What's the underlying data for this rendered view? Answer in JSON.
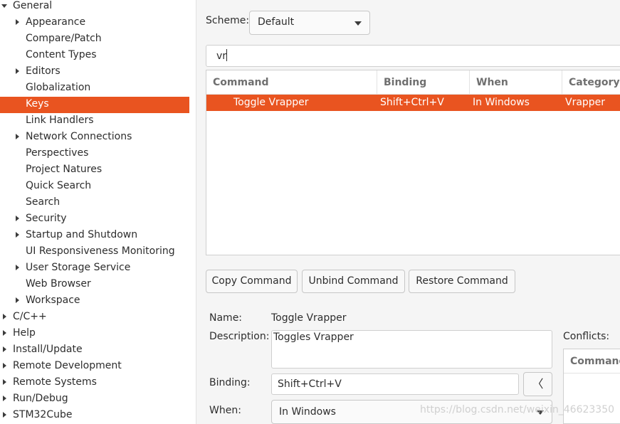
{
  "tree": {
    "items": [
      {
        "label": "General",
        "expander": "down",
        "level": 0
      },
      {
        "label": "Appearance",
        "expander": "right",
        "level": 1
      },
      {
        "label": "Compare/Patch",
        "expander": "none",
        "level": 1
      },
      {
        "label": "Content Types",
        "expander": "none",
        "level": 1
      },
      {
        "label": "Editors",
        "expander": "right",
        "level": 1
      },
      {
        "label": "Globalization",
        "expander": "none",
        "level": 1
      },
      {
        "label": "Keys",
        "expander": "none",
        "level": 1,
        "selected": true
      },
      {
        "label": "Link Handlers",
        "expander": "none",
        "level": 1
      },
      {
        "label": "Network Connections",
        "expander": "right",
        "level": 1
      },
      {
        "label": "Perspectives",
        "expander": "none",
        "level": 1
      },
      {
        "label": "Project Natures",
        "expander": "none",
        "level": 1
      },
      {
        "label": "Quick Search",
        "expander": "none",
        "level": 1
      },
      {
        "label": "Search",
        "expander": "none",
        "level": 1
      },
      {
        "label": "Security",
        "expander": "right",
        "level": 1
      },
      {
        "label": "Startup and Shutdown",
        "expander": "right",
        "level": 1
      },
      {
        "label": "UI Responsiveness Monitoring",
        "expander": "none",
        "level": 1
      },
      {
        "label": "User Storage Service",
        "expander": "right",
        "level": 1
      },
      {
        "label": "Web Browser",
        "expander": "none",
        "level": 1
      },
      {
        "label": "Workspace",
        "expander": "right",
        "level": 1
      },
      {
        "label": "C/C++",
        "expander": "right",
        "level": 0
      },
      {
        "label": "Help",
        "expander": "right",
        "level": 0
      },
      {
        "label": "Install/Update",
        "expander": "right",
        "level": 0
      },
      {
        "label": "Remote Development",
        "expander": "right",
        "level": 0
      },
      {
        "label": "Remote Systems",
        "expander": "right",
        "level": 0
      },
      {
        "label": "Run/Debug",
        "expander": "right",
        "level": 0
      },
      {
        "label": "STM32Cube",
        "expander": "right",
        "level": 0
      }
    ]
  },
  "scheme": {
    "label": "Scheme:",
    "value": "Default"
  },
  "filter": {
    "value": "vr"
  },
  "commands_table": {
    "headers": [
      "Command",
      "Binding",
      "When",
      "Category"
    ],
    "rows": [
      {
        "command": "Toggle Vrapper",
        "binding": "Shift+Ctrl+V",
        "when": "In Windows",
        "category": "Vrapper",
        "selected": true
      }
    ]
  },
  "buttons": {
    "copy": "Copy Command",
    "unbind": "Unbind Command",
    "restore": "Restore Command"
  },
  "details": {
    "name_label": "Name:",
    "name_value": "Toggle Vrapper",
    "description_label": "Description:",
    "description_value": "Toggles Vrapper",
    "binding_label": "Binding:",
    "binding_value": "Shift+Ctrl+V",
    "binding_menu_glyph": "〈",
    "when_label": "When:",
    "when_value": "In Windows"
  },
  "conflicts": {
    "label": "Conflicts:",
    "header": "Command"
  },
  "watermark": "https://blog.csdn.net/weixin_46623350",
  "colors": {
    "selection": "#e95420"
  }
}
